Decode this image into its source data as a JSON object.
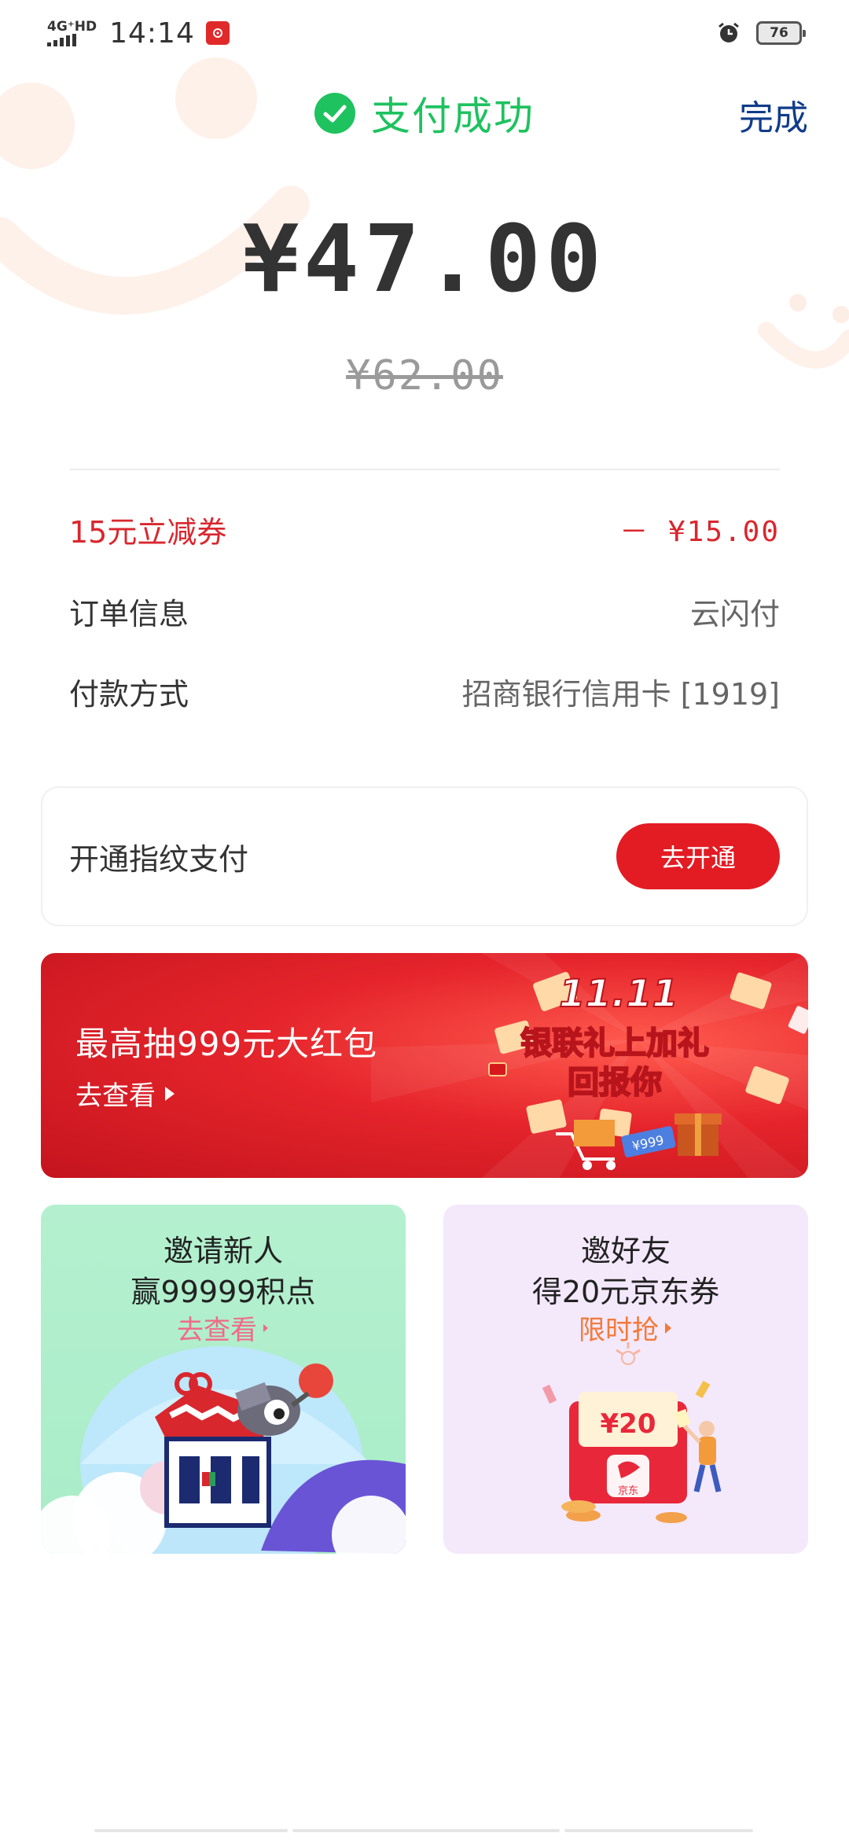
{
  "status_bar": {
    "network": "4G⁺HD",
    "time": "14:14",
    "battery": "76"
  },
  "header": {
    "title": "支付成功",
    "done_label": "完成"
  },
  "payment": {
    "amount": "¥47.00",
    "original_amount": "¥62.00"
  },
  "details": [
    {
      "label": "15元立减券",
      "value": "－ ¥15.00"
    },
    {
      "label": "订单信息",
      "value": "云闪付"
    },
    {
      "label": "付款方式",
      "value": "招商银行信用卡 [1919]"
    }
  ],
  "fingerprint": {
    "label": "开通指纹支付",
    "button": "去开通"
  },
  "banner": {
    "title": "最高抽999元大红包",
    "link": "去查看",
    "art_line1": "11.11",
    "art_line2": "银联礼上加礼",
    "art_line3": "回报你",
    "art_tag": "¥999"
  },
  "promos": [
    {
      "line1": "邀请新人",
      "line2": "赢99999积点",
      "link": "去查看"
    },
    {
      "line1": "邀好友",
      "line2": "得20元京东券",
      "link": "限时抢",
      "coupon_value": "¥20",
      "brand": "京东"
    }
  ],
  "colors": {
    "success_green": "#1ec25f",
    "brand_red": "#e31b23",
    "done_blue": "#103c8a"
  }
}
